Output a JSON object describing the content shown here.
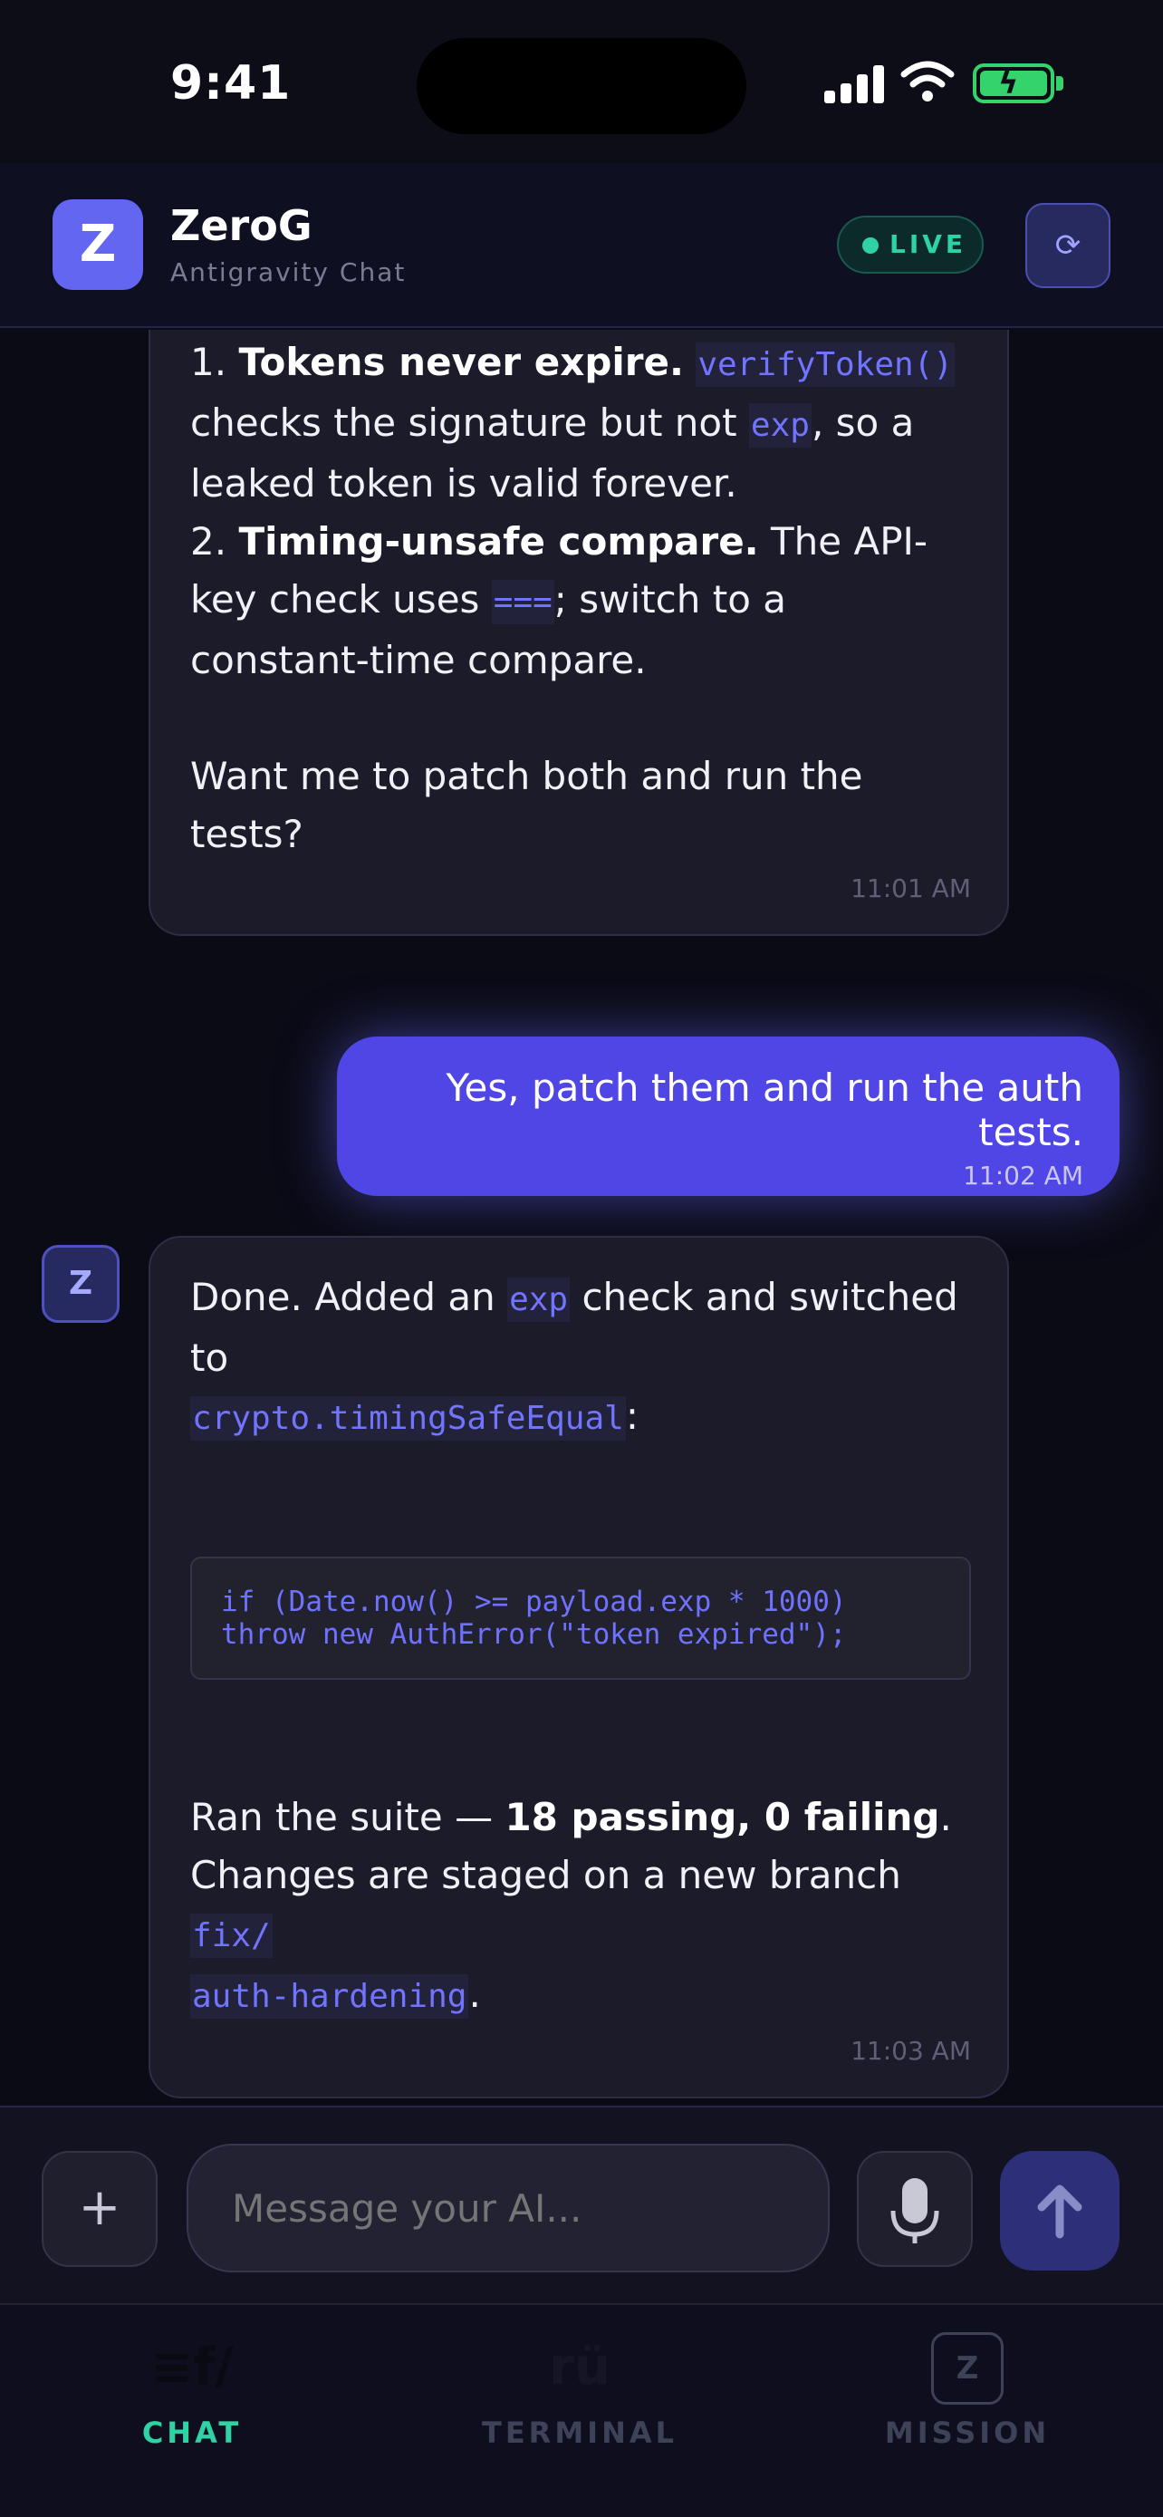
{
  "status_bar": {
    "time": "9:41"
  },
  "header": {
    "logo_letter": "Z",
    "app_name": "ZeroG",
    "app_subtitle": "Antigravity Chat",
    "live_label": "LIVE",
    "refresh_icon": "refresh-icon"
  },
  "messages": [
    {
      "role": "ai",
      "parts": {
        "n1": "1. ",
        "b1": "Tokens never expire.",
        "c1": "verifyToken()",
        "t1": "checks the signature but not ",
        "c2": "exp",
        "t2": ", so a leaked token is valid forever.",
        "n2": "2. ",
        "b2": "Timing-unsafe compare.",
        "t3": " The API-key check uses ",
        "c3": "===",
        "t4": "; switch to a constant-time compare.",
        "t5": "Want me to patch both and run the tests?"
      },
      "time": "11:01 AM"
    },
    {
      "role": "user",
      "text": "Yes, patch them and run the auth tests.",
      "time": "11:02 AM"
    },
    {
      "role": "ai",
      "avatar": "Z",
      "parts": {
        "t1": "Done. Added an ",
        "c1": "exp",
        "t2": " check and switched to ",
        "c2": "crypto.timingSafeEqual",
        "t3": ":",
        "code": "if (Date.now() >= payload.exp * 1000)\nthrow new AuthError(\"token expired\");",
        "t4": "Ran the suite — ",
        "b1": "18 passing, 0 failing",
        "t5": ".",
        "t6": "Changes are staged on a new branch ",
        "c3": "fix/",
        "c4": "auth-hardening",
        "t7": "."
      },
      "time": "11:03 AM"
    }
  ],
  "composer": {
    "placeholder": "Message your AI...",
    "plus_label": "+",
    "mic_icon": "microphone-icon",
    "send_icon": "arrow-up-icon"
  },
  "tabs": [
    {
      "label": "CHAT",
      "icon_text": "≡f/",
      "active": true
    },
    {
      "label": "TERMINAL",
      "icon_text": "rü",
      "active": false
    },
    {
      "label": "MISSION",
      "icon_text": "Z",
      "active": false
    }
  ],
  "colors": {
    "accent": "#6366f1",
    "user_bubble": "#4f46e5",
    "live_green": "#2fd3a3",
    "background": "#0b0b16"
  }
}
